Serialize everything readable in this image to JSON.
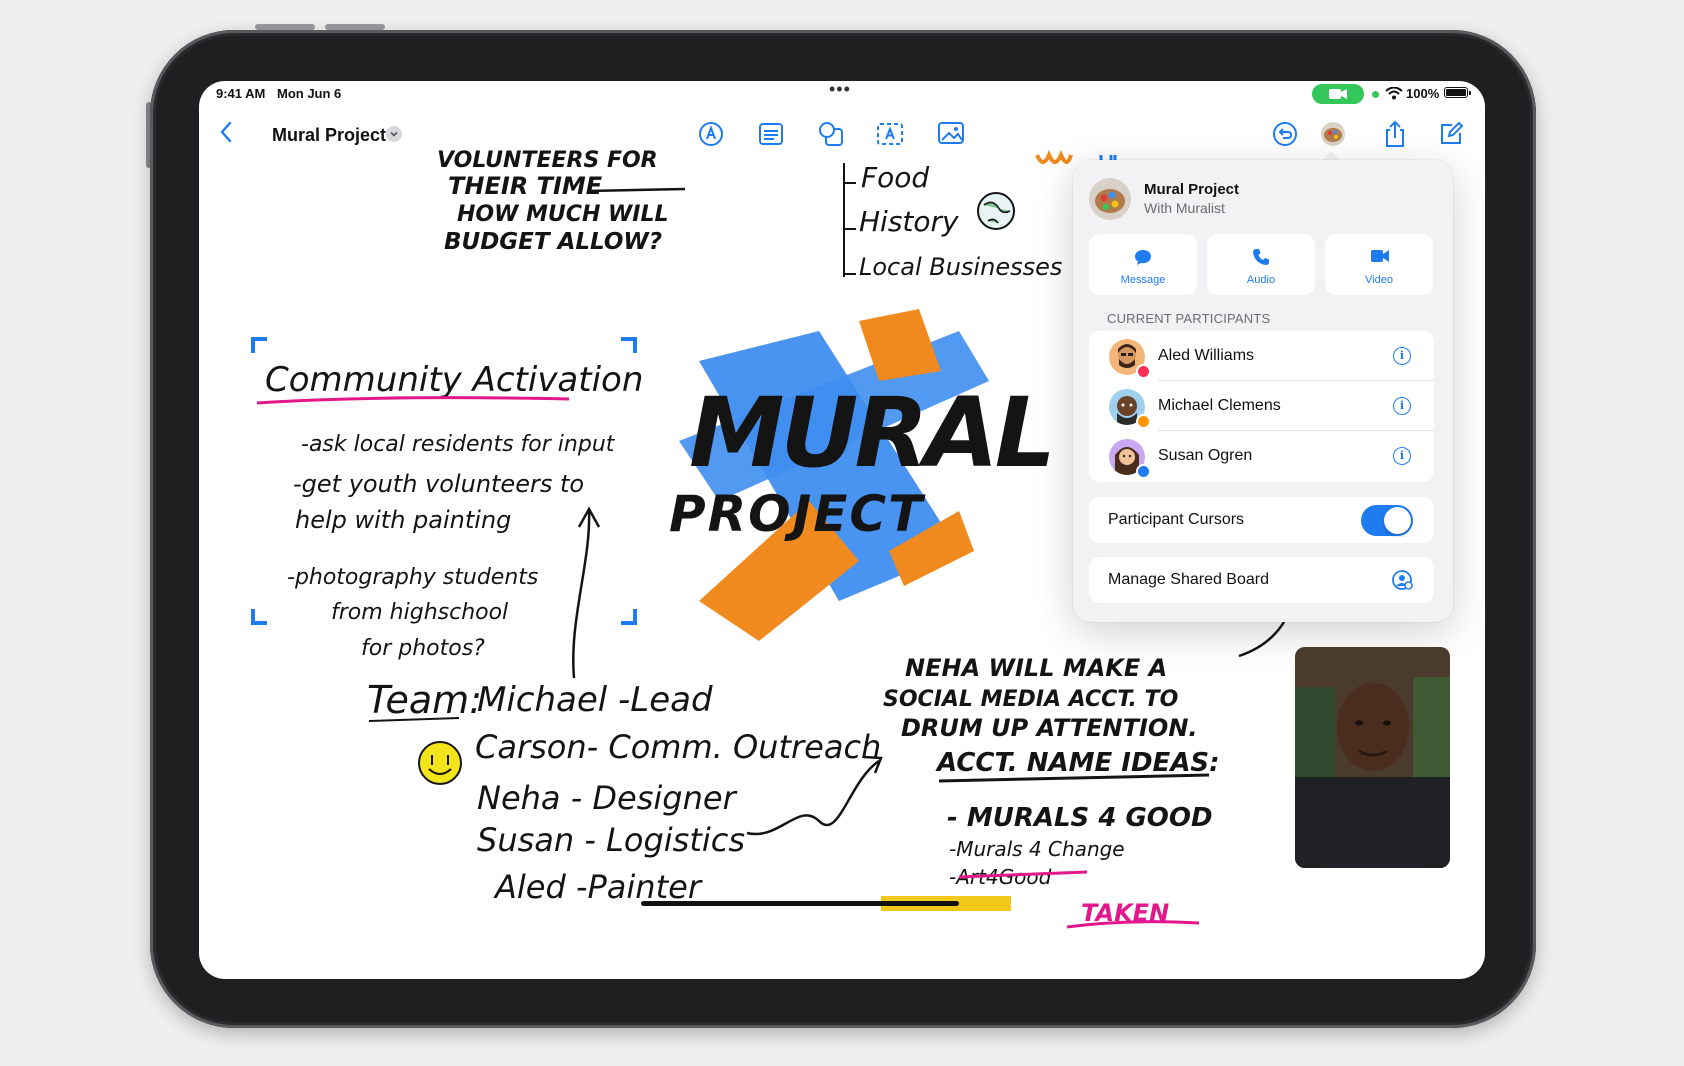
{
  "status_bar": {
    "time": "9:41 AM",
    "date": "Mon Jun 6",
    "battery": "100%"
  },
  "toolbar": {
    "board_title": "Mural Project",
    "icons": [
      "back-chevron-icon",
      "pen-icon",
      "text-block-icon",
      "shapes-icon",
      "textbox-icon",
      "media-icon",
      "undo-icon",
      "collaborator-icon",
      "share-icon",
      "compose-icon"
    ]
  },
  "canvas": {
    "top_note_lines": [
      "VOLUNTEERS FOR",
      "THEIR TIME",
      "HOW MUCH WILL",
      "BUDGET ALLOW?"
    ],
    "topics": [
      "Food",
      "History",
      "Local Businesses"
    ],
    "heading": "Community Activation",
    "bullets": [
      "-ask local residents for input",
      "-get youth volunteers to",
      "help with painting",
      "-photography students",
      "from highschool",
      "for photos?"
    ],
    "mural_title": "MURAL",
    "mural_subtitle": "PROJECT",
    "team_label": "Team:",
    "team": [
      "Michael -Lead",
      "Carson- Comm. Outreach",
      "Neha - Designer",
      "Susan - Logistics",
      "Aled -Painter"
    ],
    "neha_note": [
      "NEHA WILL MAKE A",
      "SOCIAL MEDIA ACCT. TO",
      "DRUM UP ATTENTION.",
      "ACCT. NAME IDEAS:"
    ],
    "ideas": [
      "- MURALS 4 GOOD",
      "-Murals 4 Change",
      "-Art4Good"
    ],
    "taken": "TAKEN"
  },
  "collab_panel": {
    "board": "Mural Project",
    "subtitle": "With Muralist",
    "actions": [
      {
        "label": "Message",
        "icon": "message-icon"
      },
      {
        "label": "Audio",
        "icon": "phone-icon"
      },
      {
        "label": "Video",
        "icon": "video-icon"
      }
    ],
    "section": "CURRENT PARTICIPANTS",
    "participants": [
      {
        "name": "Aled Williams",
        "badge": "#ff2d55"
      },
      {
        "name": "Michael Clemens",
        "badge": "#ff9500"
      },
      {
        "name": "Susan Ogren",
        "badge": "#1f7cf0"
      }
    ],
    "cursors_label": "Participant Cursors",
    "cursors_on": true,
    "manage_label": "Manage Shared Board"
  },
  "colors": {
    "accent": "#1f7cf0",
    "mural_blue": "#3f8ef0",
    "mural_orange": "#f08a1e",
    "highlight_pink": "#e2178c"
  }
}
